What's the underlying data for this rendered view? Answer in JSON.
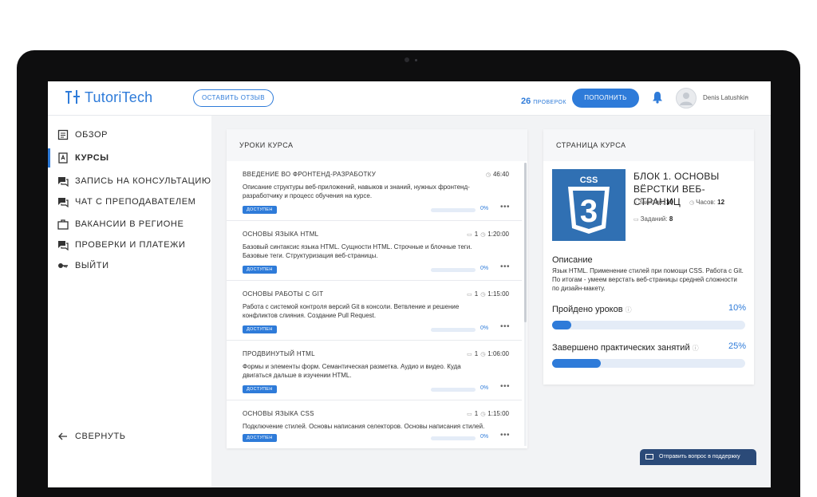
{
  "header": {
    "logo_text": "TutoriTech",
    "review_button": "ОСТАВИТЬ ОТЗЫВ",
    "checks_count": "26",
    "checks_label": "ПРОВЕРОК",
    "topup_button": "ПОПОЛНИТЬ",
    "user_name": "Denis Latushkin"
  },
  "sidebar": {
    "items": [
      {
        "label": "ОБЗОР",
        "icon": "overview-icon",
        "active": false
      },
      {
        "label": "КУРСЫ",
        "icon": "courses-icon",
        "active": true
      },
      {
        "label": "ЗАПИСЬ НА КОНСУЛЬТАЦИЮ",
        "icon": "consultation-icon",
        "active": false
      },
      {
        "label": "ЧАТ С ПРЕПОДАВАТЕЛЕМ",
        "icon": "chat-icon",
        "active": false
      },
      {
        "label": "ВАКАНСИИ В РЕГИОНЕ",
        "icon": "briefcase-icon",
        "active": false
      },
      {
        "label": "ПРОВЕРКИ И ПЛАТЕЖИ",
        "icon": "payments-icon",
        "active": false
      },
      {
        "label": "ВЫЙТИ",
        "icon": "key-icon",
        "active": false
      }
    ],
    "collapse_label": "СВЕРНУТЬ"
  },
  "lessons": {
    "title": "УРОКИ КУРСА",
    "items": [
      {
        "title": "ВВЕДЕНИЕ ВО ФРОНТЕНД-РАЗРАБОТКУ",
        "count": "",
        "duration": "46:40",
        "description": "Описание структуры веб-приложений, навыков и знаний, нужных фронтенд-разработчику и процесс обучения на курсе.",
        "badge": "ДОСТУПЕН",
        "progress": "0%",
        "progress_value": 0
      },
      {
        "title": "ОСНОВЫ ЯЗЫКА HTML",
        "count": "1",
        "duration": "1:20:00",
        "description": "Базовый синтаксис языка HTML. Сущности HTML. Строчные и блочные теги. Базовые теги. Структуризация веб-страницы.",
        "badge": "ДОСТУПЕН",
        "progress": "0%",
        "progress_value": 0
      },
      {
        "title": "ОСНОВЫ РАБОТЫ С GIT",
        "count": "1",
        "duration": "1:15:00",
        "description": "Работа с системой контроля версий Git в консоли. Ветвление и решение конфликтов слияния. Создание Pull Request.",
        "badge": "ДОСТУПЕН",
        "progress": "0%",
        "progress_value": 0
      },
      {
        "title": "ПРОДВИНУТЫЙ HTML",
        "count": "1",
        "duration": "1:06:00",
        "description": "Формы и элементы форм. Семантическая разметка. Аудио и видео. Куда двигаться дальше в изучении HTML.",
        "badge": "ДОСТУПЕН",
        "progress": "0%",
        "progress_value": 0
      },
      {
        "title": "ОСНОВЫ ЯЗЫКА CSS",
        "count": "1",
        "duration": "1:15:00",
        "description": "Подключение стилей. Основы написания селекторов. Основы написания стилей.",
        "badge": "ДОСТУПЕН",
        "progress": "0%",
        "progress_value": 0
      }
    ]
  },
  "course": {
    "title": "СТРАНИЦА КУРСА",
    "logo_text": "CSS",
    "logo_digit": "3",
    "block_title": "БЛОК 1. ОСНОВЫ ВЁРСТКИ ВЕБ-СТРАНИЦ",
    "lessons_label": "Занятий:",
    "lessons_value": "10",
    "hours_label": "Часов:",
    "hours_value": "12",
    "tasks_label": "Заданий:",
    "tasks_value": "8",
    "description_title": "Описание",
    "description_text": "Язык HTML. Применение стилей при помощи CSS. Работа с Git. По итогам - умеем верстать веб-страницы средней сложности по дизайн-макету.",
    "lessons_passed_label": "Пройдено уроков",
    "lessons_passed_pct": "10%",
    "lessons_passed_value": 10,
    "practice_label": "Завершено практических занятий",
    "practice_pct": "25%",
    "practice_value": 25
  },
  "support": {
    "label": "Отправить вопрос в поддержку"
  },
  "colors": {
    "accent": "#2e7bd9",
    "css_logo": "#3070b3",
    "support": "#2b4a78"
  }
}
